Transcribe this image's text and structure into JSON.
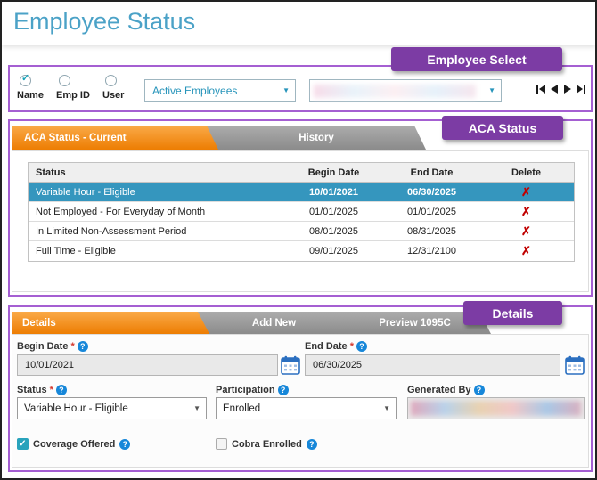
{
  "page": {
    "title": "Employee Status"
  },
  "callouts": {
    "employee_select": "Employee Select",
    "aca_status": "ACA Status",
    "details": "Details"
  },
  "icons": {
    "check": "✓",
    "chevron": "▼",
    "delete": "✗",
    "help": "?"
  },
  "colors": {
    "title_blue": "#4BA2C7",
    "accent_teal": "#2694BA",
    "tab_orange": "#ED7D02",
    "tab_gray": "#9A9A9A",
    "callout_purple": "#7C3CA4",
    "outline_purple": "#A55FD2",
    "selected_row_teal": "#3596BE",
    "delete_red": "#C00000",
    "help_blue": "#1787D9"
  },
  "employee_select": {
    "modes": [
      {
        "label": "Name",
        "selected": true
      },
      {
        "label": "Emp ID",
        "selected": false
      },
      {
        "label": "User",
        "selected": false
      }
    ],
    "filter_value": "Active Employees",
    "employee_value": ""
  },
  "aca": {
    "tabs": [
      {
        "label": "ACA Status - Current",
        "active": true
      },
      {
        "label": "History",
        "active": false
      }
    ],
    "headers": [
      "Status",
      "Begin Date",
      "End Date",
      "Delete"
    ],
    "rows": [
      {
        "status": "Variable Hour - Eligible",
        "begin": "10/01/2021",
        "end": "06/30/2025",
        "selected": true
      },
      {
        "status": "Not Employed - For Everyday of Month",
        "begin": "01/01/2025",
        "end": "01/01/2025",
        "selected": false
      },
      {
        "status": "In Limited Non-Assessment Period",
        "begin": "08/01/2025",
        "end": "08/31/2025",
        "selected": false
      },
      {
        "status": "Full Time - Eligible",
        "begin": "09/01/2025",
        "end": "12/31/2100",
        "selected": false
      }
    ]
  },
  "details": {
    "tabs": [
      {
        "label": "Details",
        "active": true
      },
      {
        "label": "Add New",
        "active": false
      },
      {
        "label": "Preview 1095C",
        "active": false
      }
    ],
    "required_marker": "*",
    "begin_date": {
      "label": "Begin Date",
      "value": "10/01/2021"
    },
    "end_date": {
      "label": "End Date",
      "value": "06/30/2025"
    },
    "status": {
      "label": "Status",
      "value": "Variable Hour - Eligible"
    },
    "participation": {
      "label": "Participation",
      "value": "Enrolled"
    },
    "generated_by": {
      "label": "Generated By",
      "value": ""
    },
    "coverage_offered": {
      "label": "Coverage Offered",
      "checked": true
    },
    "cobra_enrolled": {
      "label": "Cobra Enrolled",
      "checked": false
    }
  }
}
